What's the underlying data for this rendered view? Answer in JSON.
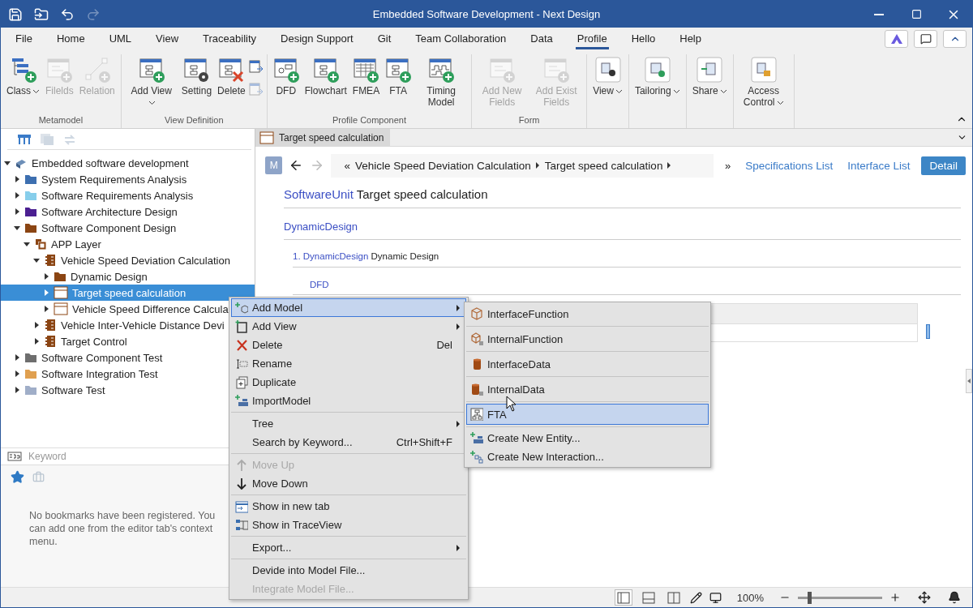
{
  "window": {
    "title": "Embedded Software Development - Next Design"
  },
  "quick_access": [
    {
      "disabled": false
    },
    {
      "disabled": false
    },
    {
      "disabled": false
    },
    {
      "disabled": true
    }
  ],
  "menu_tabs": [
    {
      "label": "File",
      "selected": false
    },
    {
      "label": "Home",
      "selected": false
    },
    {
      "label": "UML",
      "selected": false
    },
    {
      "label": "View",
      "selected": false
    },
    {
      "label": "Traceability",
      "selected": false
    },
    {
      "label": "Design Support",
      "selected": false
    },
    {
      "label": "Git",
      "selected": false
    },
    {
      "label": "Team Collaboration",
      "selected": false
    },
    {
      "label": "Data",
      "selected": false
    },
    {
      "label": "Profile",
      "selected": true
    },
    {
      "label": "Hello",
      "selected": false
    },
    {
      "label": "Help",
      "selected": false
    }
  ],
  "ribbon": {
    "groups": [
      {
        "label": "Metamodel",
        "buttons": [
          {
            "label": "Class",
            "disabled": false,
            "dropdown": true
          },
          {
            "label": "Filelds",
            "disabled": true,
            "dropdown": false
          },
          {
            "label": "Relation",
            "disabled": true,
            "dropdown": false
          }
        ]
      },
      {
        "label": "View Definition",
        "buttons": [
          {
            "label": "Add View",
            "disabled": false,
            "dropdown": true
          },
          {
            "label": "Setting",
            "disabled": false,
            "dropdown": false
          },
          {
            "label": "Delete",
            "disabled": false,
            "dropdown": false
          }
        ],
        "small_buttons": [
          {
            "disabled": false
          },
          {
            "disabled": true
          }
        ]
      },
      {
        "label": "Profile Component",
        "buttons": [
          {
            "label": "DFD",
            "disabled": false,
            "dropdown": false
          },
          {
            "label": "Flowchart",
            "disabled": false,
            "dropdown": false
          },
          {
            "label": "FMEA",
            "disabled": false,
            "dropdown": false
          },
          {
            "label": "FTA",
            "disabled": false,
            "dropdown": false
          },
          {
            "label": "Timing Model",
            "disabled": false,
            "dropdown": false
          }
        ]
      },
      {
        "label": "Form",
        "buttons": [
          {
            "label": "Add New Fields",
            "disabled": true,
            "dropdown": false
          },
          {
            "label": "Add Exist Fields",
            "disabled": true,
            "dropdown": false
          }
        ]
      },
      {
        "buttons": [
          {
            "label": "View",
            "disabled": false,
            "dropdown": true
          }
        ]
      },
      {
        "buttons": [
          {
            "label": "Tailoring",
            "disabled": false,
            "dropdown": true
          }
        ]
      },
      {
        "buttons": [
          {
            "label": "Share",
            "disabled": false,
            "dropdown": true
          }
        ]
      },
      {
        "buttons": [
          {
            "label": "Access Control",
            "disabled": false,
            "dropdown": true
          }
        ]
      }
    ]
  },
  "tree": {
    "nodes": [
      {
        "label": "Embedded software development",
        "kind": "root",
        "expanded": true,
        "selected": false,
        "children": [
          {
            "label": "System Requirements Analysis",
            "kind": "folder",
            "color": "#3d6fb0",
            "expanded": false,
            "selected": false
          },
          {
            "label": "Software Requirements Analysis",
            "kind": "folder",
            "color": "#87ceeb",
            "expanded": false,
            "selected": false
          },
          {
            "label": "Software Architecture Design",
            "kind": "folder",
            "color": "#4b1f91",
            "expanded": false,
            "selected": false
          },
          {
            "label": "Software Component Design",
            "kind": "folder",
            "color": "#8b4513",
            "expanded": true,
            "selected": false,
            "children": [
              {
                "label": "APP Layer",
                "kind": "layer",
                "expanded": true,
                "selected": false,
                "children": [
                  {
                    "label": "Vehicle Speed Deviation Calculation",
                    "kind": "component",
                    "expanded": true,
                    "selected": false,
                    "children": [
                      {
                        "label": "Dynamic Design",
                        "kind": "folder",
                        "color": "#8b4513",
                        "expanded": false,
                        "selected": false
                      },
                      {
                        "label": "Target speed calculation",
                        "kind": "unit",
                        "expanded": false,
                        "selected": true
                      },
                      {
                        "label": "Vehicle Speed Difference Calcula",
                        "kind": "unit",
                        "expanded": false,
                        "selected": false
                      }
                    ]
                  },
                  {
                    "label": "Vehicle Inter-Vehicle Distance Devi",
                    "kind": "component",
                    "expanded": false,
                    "selected": false
                  },
                  {
                    "label": "Target Control",
                    "kind": "component",
                    "expanded": false,
                    "selected": false
                  }
                ]
              }
            ]
          },
          {
            "label": "Software Component Test",
            "kind": "folder",
            "color": "#6e6e6e",
            "expanded": false,
            "selected": false
          },
          {
            "label": "Software Integration Test",
            "kind": "folder",
            "color": "#e0a050",
            "expanded": false,
            "selected": false
          },
          {
            "label": "Software Test",
            "kind": "folder",
            "color": "#a0aec8",
            "expanded": false,
            "selected": false
          }
        ]
      }
    ]
  },
  "search": {
    "placeholder": "Keyword"
  },
  "bookmarks": {
    "tabs": [
      {
        "selected": true
      },
      {
        "selected": false
      }
    ],
    "message": "No bookmarks have been registered. You can add one from the editor tab's context menu."
  },
  "editor": {
    "tab": {
      "label": "Target speed calculation",
      "selected": true
    },
    "badge": "M",
    "breadcrumb": {
      "start": "«",
      "items": [
        "Vehicle Speed Deviation Calculation",
        "Target speed calculation"
      ],
      "more": "»"
    },
    "links": [
      "Specifications List",
      "Interface List"
    ],
    "detail_button": "Detail",
    "heading": {
      "type": "SoftwareUnit",
      "name": "Target speed calculation"
    },
    "section": "DynamicDesign",
    "item": {
      "number": "1.",
      "type": "DynamicDesign",
      "name": "Dynamic Design"
    },
    "subsection": "DFD"
  },
  "context_menu": {
    "groups": [
      {
        "items": [
          {
            "label": "Add Model",
            "submenu": true,
            "selected": true,
            "disabled": false
          },
          {
            "label": "Add View",
            "submenu": true,
            "selected": false,
            "disabled": false
          },
          {
            "label": "Delete",
            "shortcut": "Del",
            "selected": false,
            "disabled": false
          },
          {
            "label": "Rename",
            "selected": false,
            "disabled": false
          },
          {
            "label": "Duplicate",
            "selected": false,
            "disabled": false
          },
          {
            "label": "ImportModel",
            "selected": false,
            "disabled": false
          }
        ]
      },
      {
        "items": [
          {
            "label": "Tree",
            "submenu": true,
            "selected": false,
            "disabled": false
          },
          {
            "label": "Search by Keyword...",
            "shortcut": "Ctrl+Shift+F",
            "selected": false,
            "disabled": false
          }
        ]
      },
      {
        "items": [
          {
            "label": "Move Up",
            "selected": false,
            "disabled": true
          },
          {
            "label": "Move Down",
            "selected": false,
            "disabled": false
          }
        ]
      },
      {
        "items": [
          {
            "label": "Show in new tab",
            "selected": false,
            "disabled": false
          },
          {
            "label": "Show in TraceView",
            "selected": false,
            "disabled": false
          }
        ]
      },
      {
        "items": [
          {
            "label": "Export...",
            "submenu": true,
            "selected": false,
            "disabled": false
          }
        ]
      },
      {
        "items": [
          {
            "label": "Devide into Model File...",
            "selected": false,
            "disabled": false
          },
          {
            "label": "Integrate Model File...",
            "selected": false,
            "disabled": true
          }
        ]
      }
    ]
  },
  "submenu": {
    "groups": [
      {
        "items": [
          {
            "label": "InterfaceFunction",
            "selected": false
          }
        ]
      },
      {
        "items": [
          {
            "label": "InternalFunction",
            "selected": false
          }
        ]
      },
      {
        "items": [
          {
            "label": "InterfaceData",
            "selected": false
          }
        ]
      },
      {
        "items": [
          {
            "label": "InternalData",
            "selected": false
          }
        ]
      },
      {
        "items": [
          {
            "label": "FTA",
            "selected": true
          }
        ]
      },
      {
        "items": [
          {
            "label": "Create New Entity...",
            "selected": false
          },
          {
            "label": "Create New Interaction...",
            "selected": false
          }
        ]
      }
    ]
  },
  "status_bar": {
    "layouts": [
      {
        "selected": true
      },
      {
        "selected": false
      },
      {
        "selected": false
      }
    ],
    "zoom": "100%",
    "zoom_slider": {
      "level": 0.12
    }
  }
}
